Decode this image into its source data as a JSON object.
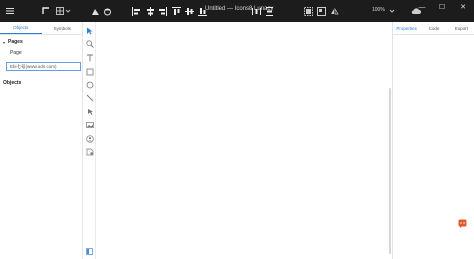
{
  "window": {
    "title": "Untitled — Icons8 Lunacy",
    "zoom": "100%",
    "controls": [
      "—",
      "☐",
      "✕"
    ]
  },
  "left_panel": {
    "tabs": [
      {
        "label": "Objects",
        "active": true
      },
      {
        "label": "Symbols",
        "active": false
      }
    ],
    "pages_header": "Pages",
    "page_item": "Page",
    "page_name_input_value": "Ebi七号(www.udn.com)",
    "objects_header": "Objects"
  },
  "right_panel": {
    "tabs": [
      {
        "label": "Properties",
        "active": true
      },
      {
        "label": "Code",
        "active": false
      },
      {
        "label": "Export",
        "active": false
      }
    ]
  },
  "colors": {
    "titlebar": "#1c1c1c",
    "accent": "#2d7bd8",
    "feedback": "#e25a2a"
  }
}
